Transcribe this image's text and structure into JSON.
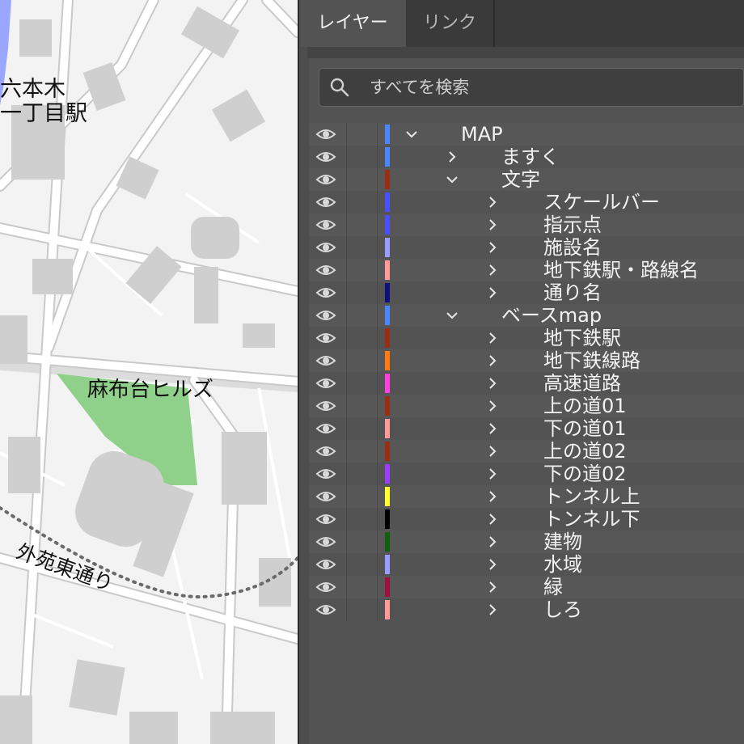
{
  "map": {
    "labels": {
      "station": "六本木\n一丁目駅",
      "hills": "麻布台ヒルズ",
      "road": "外苑東通り"
    }
  },
  "panel": {
    "tabs": {
      "layers": "レイヤー",
      "links": "リンク"
    },
    "search": {
      "placeholder": "すべてを検索"
    },
    "layers": [
      {
        "name": "MAP",
        "color": "#4a86ff",
        "level": 0,
        "expanded": true
      },
      {
        "name": "ますく",
        "color": "#4a86ff",
        "level": 1,
        "expanded": false
      },
      {
        "name": "文字",
        "color": "#9a2e12",
        "level": 1,
        "expanded": true
      },
      {
        "name": "スケールバー",
        "color": "#4a4fff",
        "level": 2,
        "expanded": false
      },
      {
        "name": "指示点",
        "color": "#4a4fff",
        "level": 2,
        "expanded": false
      },
      {
        "name": "施設名",
        "color": "#9a9cff",
        "level": 2,
        "expanded": false
      },
      {
        "name": "地下鉄駅・路線名",
        "color": "#ff9a9a",
        "level": 2,
        "expanded": false
      },
      {
        "name": "通り名",
        "color": "#10107a",
        "level": 2,
        "expanded": false
      },
      {
        "name": "ベースmap",
        "color": "#4a86ff",
        "level": 1,
        "expanded": true
      },
      {
        "name": "地下鉄駅",
        "color": "#9a2e12",
        "level": 2,
        "expanded": false
      },
      {
        "name": "地下鉄線路",
        "color": "#ff7a10",
        "level": 2,
        "expanded": false
      },
      {
        "name": "高速道路",
        "color": "#ff3fe0",
        "level": 2,
        "expanded": false
      },
      {
        "name": "上の道01",
        "color": "#9a2e12",
        "level": 2,
        "expanded": false
      },
      {
        "name": "下の道01",
        "color": "#ff9a9a",
        "level": 2,
        "expanded": false
      },
      {
        "name": "上の道02",
        "color": "#9a2e12",
        "level": 2,
        "expanded": false
      },
      {
        "name": "下の道02",
        "color": "#9a3fff",
        "level": 2,
        "expanded": false
      },
      {
        "name": "トンネル上",
        "color": "#ffff33",
        "level": 2,
        "expanded": false
      },
      {
        "name": "トンネル下",
        "color": "#000000",
        "level": 2,
        "expanded": false
      },
      {
        "name": "建物",
        "color": "#106010",
        "level": 2,
        "expanded": false
      },
      {
        "name": "水域",
        "color": "#9a9cff",
        "level": 2,
        "expanded": false
      },
      {
        "name": "緑",
        "color": "#a0103f",
        "level": 2,
        "expanded": false
      },
      {
        "name": "しろ",
        "color": "#ff9a9a",
        "level": 2,
        "expanded": false
      }
    ]
  }
}
